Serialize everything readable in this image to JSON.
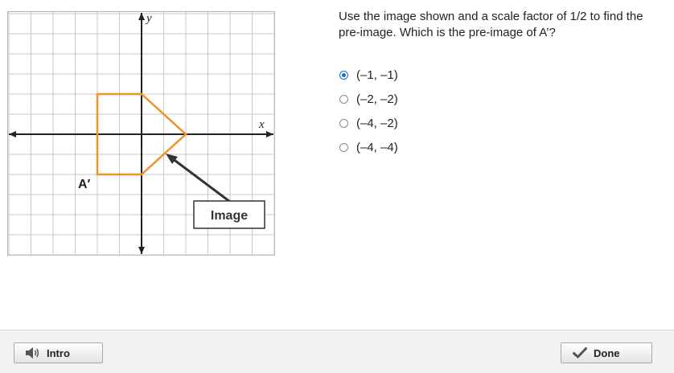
{
  "question": {
    "text": "Use the image shown and a scale factor of 1/2 to find the pre-image. Which is the pre-image of A’?"
  },
  "choices": [
    {
      "label": "(–1, –1)",
      "selected": true
    },
    {
      "label": "(–2, –2)",
      "selected": false
    },
    {
      "label": "(–4, –2)",
      "selected": false
    },
    {
      "label": "(–4, –4)",
      "selected": false
    }
  ],
  "graph": {
    "x_axis_label": "x",
    "y_axis_label": "y",
    "point_label": "A′",
    "callout_label": "Image",
    "x_range": [
      -6,
      6
    ],
    "y_range": [
      -6,
      6
    ],
    "grid": true,
    "image_polygon": [
      [
        -2,
        2
      ],
      [
        0,
        2
      ],
      [
        2,
        0
      ],
      [
        0,
        -2
      ],
      [
        -2,
        -2
      ]
    ],
    "colors": {
      "polygon": "#f0922a",
      "grid": "#c8c8c8",
      "axis": "#222222"
    }
  },
  "footer": {
    "intro_label": "Intro",
    "done_label": "Done",
    "intro_icon": "speaker-icon",
    "done_icon": "checkmark-icon"
  }
}
